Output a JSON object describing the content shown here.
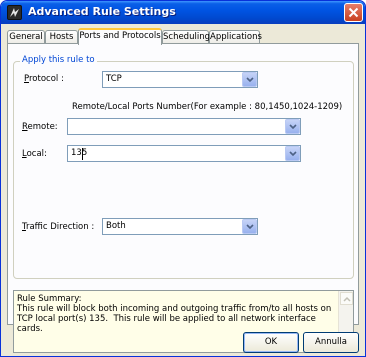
{
  "window": {
    "title": "Advanced Rule Settings",
    "close_icon": "close-icon",
    "app_icon": "firewall-app-icon"
  },
  "tabs": [
    {
      "label": "General",
      "active": false
    },
    {
      "label": "Hosts",
      "active": false
    },
    {
      "label": "Ports and Protocols",
      "active": true
    },
    {
      "label": "Scheduling",
      "active": false
    },
    {
      "label": "Applications",
      "active": false
    }
  ],
  "group": {
    "title": "Apply this rule to"
  },
  "protocol": {
    "label": "Protocol :",
    "value": "TCP"
  },
  "ports_hint": "Remote/Local Ports Number(For example : 80,1450,1024-1209)",
  "remote": {
    "label": "Remote:",
    "value": ""
  },
  "local": {
    "label": "Local:",
    "value": "135"
  },
  "traffic_direction": {
    "label": "Traffic Direction :",
    "value": "Both"
  },
  "summary": {
    "text": "Rule Summary:\nThis rule will block both incoming and outgoing traffic from/to all hosts on TCP local port(s) 135.  This rule will be applied to all network interface cards."
  },
  "buttons": {
    "ok": "OK",
    "cancel": "Annulla"
  },
  "colors": {
    "titlebar": "#0054e3",
    "group_title": "#0046d5",
    "summary_bg": "#fffee8",
    "active_tab_highlight": "#ffc83c"
  }
}
